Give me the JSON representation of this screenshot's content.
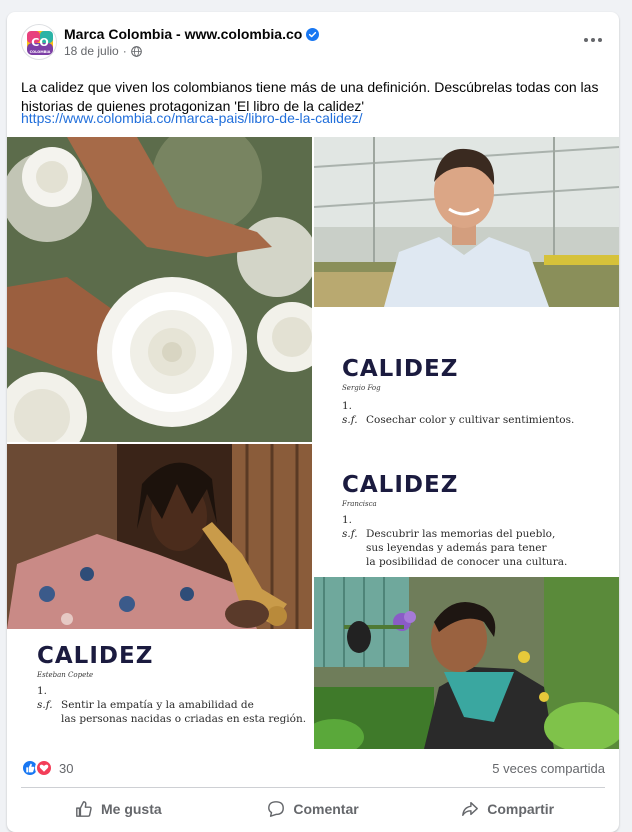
{
  "post": {
    "page_name": "Marca Colombia - www.colombia.co",
    "avatar_text": "CO",
    "avatar_subtext": "COLOMBIA",
    "date": "18 de julio",
    "separator": "·",
    "text": "La calidez que viven los colombianos tiene más de una definición. Descúbrelas todas con las historias de quienes protagonizan 'El libro de la calidez'",
    "link": "https://www.colombia.co/marca-pais/libro-de-la-calidez/"
  },
  "gallery": {
    "tile2": {
      "title": "CALIDEZ",
      "author": "Sergio Fog",
      "number": "1.",
      "abbr": "s.f.",
      "lines": [
        "Cosechar color y cultivar sentimientos."
      ]
    },
    "tile3": {
      "title": "CALIDEZ",
      "author": "Francisca",
      "number": "1.",
      "abbr": "s.f.",
      "lines": [
        "Descubrir las memorias del pueblo,",
        "sus leyendas y además para tener",
        "la posibilidad de conocer una cultura."
      ]
    },
    "tile4": {
      "title": "CALIDEZ",
      "author": "Esteban Copete",
      "number": "1.",
      "abbr": "s.f.",
      "lines": [
        "Sentir la empatía y la amabilidad de",
        "las personas nacidas o criadas en esta región."
      ]
    }
  },
  "stats": {
    "reaction_count": "30",
    "shares": "5 veces compartida"
  },
  "actions": {
    "like": "Me gusta",
    "comment": "Comentar",
    "share": "Compartir"
  },
  "colors": {
    "link": "#216fdb",
    "like_blue": "#1877f2",
    "love_red": "#f33e58",
    "calidez_navy": "#1b1b3f"
  }
}
